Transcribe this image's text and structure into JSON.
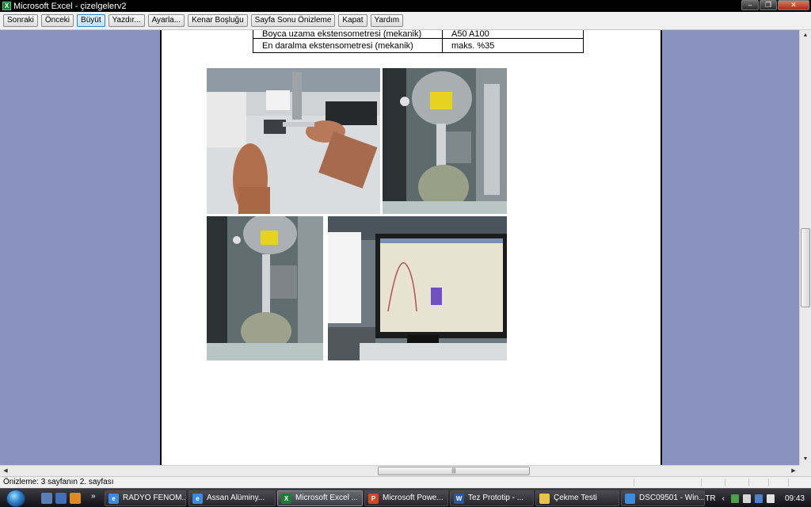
{
  "window": {
    "app_icon": "excel-icon",
    "title": "Microsoft Excel - çizelgelerv2",
    "minimize": "minimize-icon",
    "maximize": "restore-icon",
    "close": "close-icon"
  },
  "toolbar": {
    "buttons": [
      {
        "label": "Sonraki"
      },
      {
        "label": "Önceki"
      },
      {
        "label": "Büyüt"
      },
      {
        "label": "Yazdır..."
      },
      {
        "label": "Ayarla..."
      },
      {
        "label": "Kenar Boşluğu"
      },
      {
        "label": "Sayfa Sonu Önizleme"
      },
      {
        "label": "Kapat"
      },
      {
        "label": "Yardım"
      }
    ],
    "active": "Büyüt"
  },
  "sheet": {
    "rows": [
      {
        "label": "Boyca uzama ekstensometresi (mekanik)",
        "value": "A50 A100"
      },
      {
        "label": "En daralma ekstensometresi (mekanik)",
        "value": "maks. %35"
      }
    ]
  },
  "photos": [
    {
      "name": "extensometer-hands-photo"
    },
    {
      "name": "tensile-grips-photo"
    },
    {
      "name": "tensile-specimen-photo"
    },
    {
      "name": "computer-monitor-photo"
    }
  ],
  "status": {
    "text": "Önizleme:  3 sayfanın  2. sayfası"
  },
  "taskbar": {
    "start": "start-orb-icon",
    "quick_launch": [
      "show-desktop-icon",
      "switch-windows-icon",
      "media-player-icon"
    ],
    "quick_launch_more": "»",
    "items": [
      {
        "label": "RADYO FENOM...",
        "icon": "ie-icon",
        "color": "#3b8be0"
      },
      {
        "label": "Assan Alüminy...",
        "icon": "ie-icon",
        "color": "#3b8be0"
      },
      {
        "label": "Microsoft Excel ...",
        "icon": "excel-icon",
        "color": "#1f7a36"
      },
      {
        "label": "Microsoft Powe...",
        "icon": "powerpoint-icon",
        "color": "#d24726"
      },
      {
        "label": "Tez Prototip - ...",
        "icon": "word-icon",
        "color": "#2b579a"
      },
      {
        "label": "Çekme Testi",
        "icon": "folder-icon",
        "color": "#e8c24a"
      },
      {
        "label": "DSC09501 - Win...",
        "icon": "photo-viewer-icon",
        "color": "#3b8be0"
      }
    ],
    "active_index": 2,
    "tray": {
      "lang": "TR",
      "clock": "09:43"
    }
  }
}
